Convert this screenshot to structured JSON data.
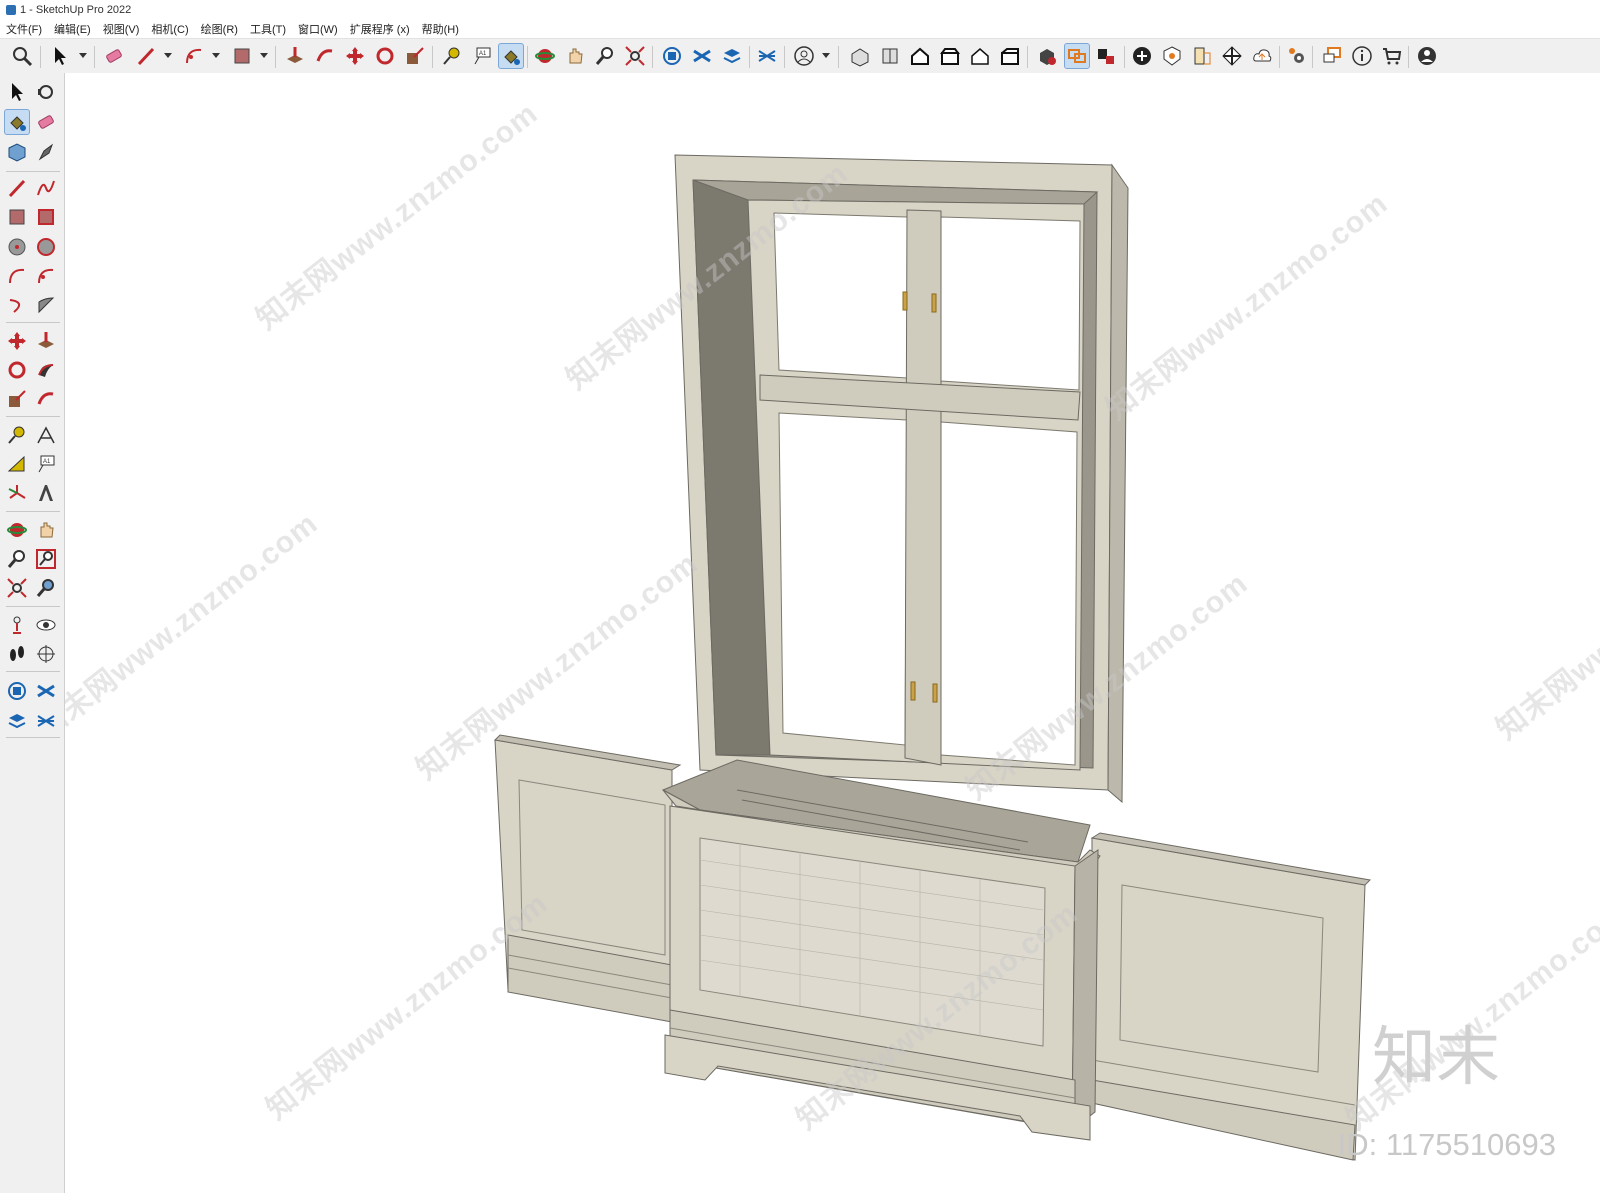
{
  "window": {
    "title": "1 - SketchUp Pro 2022"
  },
  "menu": [
    "文件(F)",
    "编辑(E)",
    "视图(V)",
    "相机(C)",
    "绘图(R)",
    "工具(T)",
    "窗口(W)",
    "扩展程序 (x)",
    "帮助(H)"
  ],
  "watermark": {
    "text": "知末网www.znzmo.com",
    "brand": "知末",
    "id": "ID: 1175510693"
  },
  "colors": {
    "model": "#d8d4c6",
    "edge": "#6c6a62",
    "shadow": "#8f8c80",
    "active_tool": "#c5dcf2"
  },
  "toolbar_icons": [
    "search-icon",
    "select-icon",
    "eraser-icon",
    "pencil-icon",
    "arc-icon",
    "rectangle-icon",
    "push-pull-icon",
    "follow-me-icon",
    "move-icon",
    "rotate-icon",
    "scale-icon",
    "tape-measure-icon",
    "text-icon",
    "paint-bucket-icon",
    "orbit-icon",
    "pan-icon",
    "zoom-icon",
    "zoom-extents-icon",
    "warehouse-icon",
    "extension-warehouse-icon",
    "layout-icon",
    "style-builder-icon",
    "account-icon",
    "iso-view-icon",
    "top-view-icon",
    "front-view-icon",
    "right-view-icon",
    "back-view-icon",
    "left-view-icon",
    "solid-tools-icon",
    "outer-shell-icon",
    "section-icon",
    "add-location-icon",
    "geo-icon",
    "info-icon",
    "checker-icon",
    "cloud-icon",
    "settings-icon",
    "messages-icon",
    "help-icon",
    "cart-icon",
    "profile-icon"
  ],
  "left_icons": [
    "select-icon",
    "orbit-icon",
    "paint-bucket-icon",
    "eraser-icon",
    "component-icon",
    "line-icon",
    "pencil-icon",
    "freehand-icon",
    "rectangle-icon",
    "rotated-rectangle-icon",
    "circle-icon",
    "polygon-icon",
    "arc-icon",
    "pie-icon",
    "two-point-arc-icon",
    "three-point-arc-icon",
    "move-icon",
    "push-pull-icon",
    "rotate-icon",
    "follow-me-icon",
    "scale-icon",
    "offset-icon",
    "tape-measure-icon",
    "dimension-icon",
    "protractor-icon",
    "text-icon",
    "axes-icon",
    "3d-text-icon",
    "orbit-icon",
    "pan-icon",
    "zoom-icon",
    "zoom-window-icon",
    "zoom-extents-icon",
    "previous-icon",
    "position-camera-icon",
    "look-around-icon",
    "walk-icon",
    "section-plane-icon",
    "warehouse-icon",
    "extension-icon",
    "layout-icon",
    "style-icon"
  ]
}
